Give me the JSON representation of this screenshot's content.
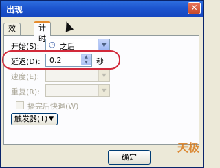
{
  "window": {
    "title": "出现",
    "close_glyph": "✕"
  },
  "tabs": [
    {
      "label": "效果",
      "active": false
    },
    {
      "label": "计时",
      "active": true
    }
  ],
  "timing": {
    "start": {
      "label": "开始(S):",
      "value": "之后"
    },
    "delay": {
      "label": "延迟(D):",
      "value": "0.2",
      "unit": "秒"
    },
    "speed": {
      "label": "速度(E):",
      "value": ""
    },
    "repeat": {
      "label": "重复(R):",
      "value": ""
    },
    "rewind": {
      "label": "播完后快退(W)",
      "checked": false
    },
    "trigger": {
      "label": "触发器(T)"
    }
  },
  "buttons": {
    "ok": "确定"
  },
  "watermark": {
    "text": "天极"
  },
  "colors": {
    "highlight": "#d2293a",
    "titlebar": "#1d55cf",
    "accent_tab": "#e68b2c"
  }
}
